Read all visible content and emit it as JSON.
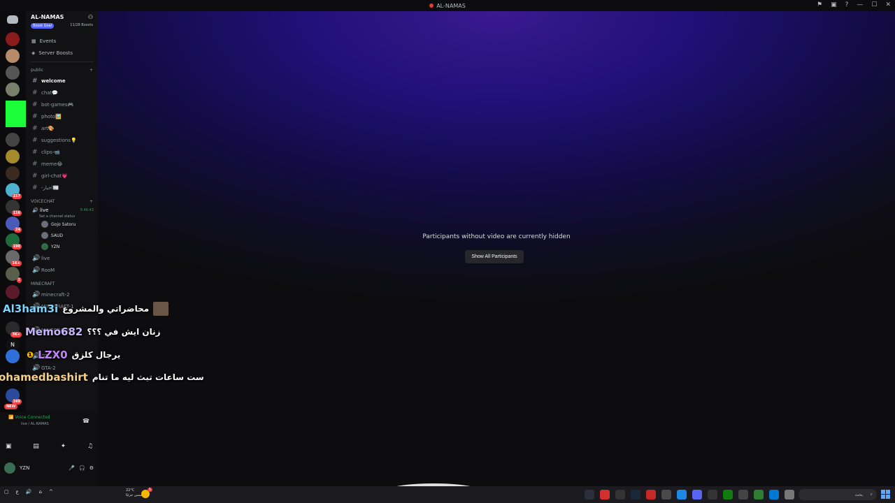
{
  "window": {
    "title": "AL-NAMAS"
  },
  "server": {
    "name": "AL-NAMAS",
    "boost_goal_label": "Boost Goal",
    "boost_progress": "11/28 Boosts",
    "boost_progress_fraction": 0.39
  },
  "nav": {
    "events": "Events",
    "server_boosts": "Server Boosts"
  },
  "categories": {
    "public": "public",
    "voicechat": "VOICECHAT",
    "minecraft": "MINECRAFT"
  },
  "channels": [
    {
      "name": "welcome",
      "active": true
    },
    {
      "name": "chat💬",
      "active": false
    },
    {
      "name": "bot-games🎮",
      "active": false
    },
    {
      "name": "photo🖼️",
      "active": false
    },
    {
      "name": "art🎨",
      "active": false
    },
    {
      "name": "suggestions💡",
      "active": false
    },
    {
      "name": "clips-📹",
      "active": false
    },
    {
      "name": "meme😂",
      "active": false
    },
    {
      "name": "girl-chat💗",
      "active": false
    },
    {
      "name": "-اخبار📰",
      "active": false
    }
  ],
  "voice": {
    "live_channel": "live",
    "timer": "5:46:43",
    "status_hint": "Set a channel status",
    "users": [
      "Gojo Satoru",
      "SAUD",
      "YZN"
    ],
    "other_channels": [
      "live",
      "RooM"
    ]
  },
  "minecraft_channels": [
    "minecraft-2",
    "MINECRAFT-1",
    "MINECRAFT-3"
  ],
  "gta_channels": [
    "GTA-1",
    "GTA-2"
  ],
  "voice_panel": {
    "connected": "Voice Connected",
    "location": "live / AL-NAMAS"
  },
  "user_bar": {
    "name": "YZN"
  },
  "stage": {
    "hidden_message": "Participants without video are currently hidden",
    "show_all_button": "Show All Participants"
  },
  "overlay_chat": [
    {
      "user": "Al3ham3i",
      "text": "محاضراتي والمشروع",
      "user_color": "#7dd3fc"
    },
    {
      "user": "Memo682",
      "text": "زنان ايش في ؟؟؟",
      "user_color": "#c4b5fd"
    },
    {
      "user": "LZX0",
      "text": "يرجال كلزق",
      "user_color": "#c084fc"
    },
    {
      "user": "ohamedbashirt",
      "text": "ست ساعات تبث ليه ما تنام",
      "user_color": "#f5d08a"
    }
  ],
  "guild_badges": [
    "217",
    "116",
    "24",
    "190",
    "1K+",
    "1",
    "3K+",
    "249",
    "NEW"
  ],
  "overlay_counter": "7",
  "taskbar": {
    "weather_temp": "22°C",
    "weather_desc": "مشمس جزئيًا",
    "search_placeholder": "بحث",
    "notif_badge": "1"
  },
  "colors": {
    "accent": "#5865f2",
    "online": "#23a55a",
    "stage_purple": "#2a0f8a"
  }
}
